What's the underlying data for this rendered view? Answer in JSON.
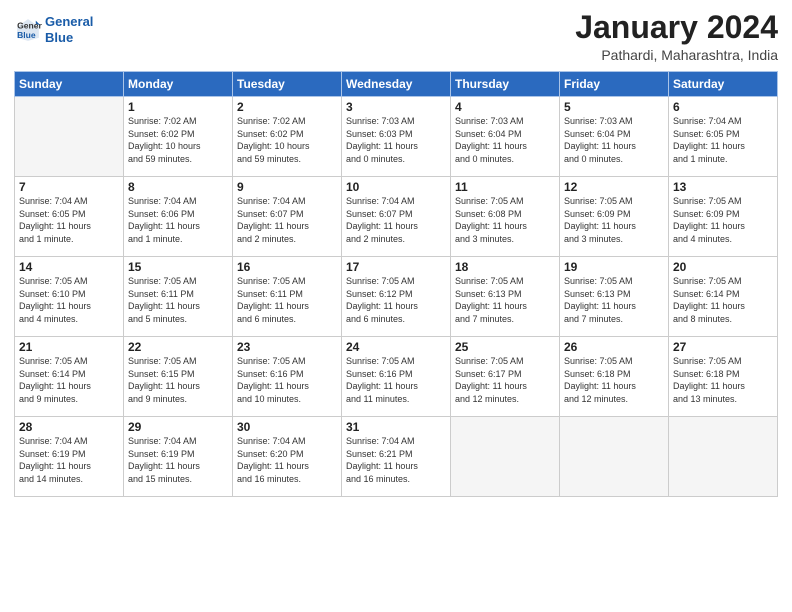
{
  "header": {
    "logo_line1": "General",
    "logo_line2": "Blue",
    "month": "January 2024",
    "location": "Pathardi, Maharashtra, India"
  },
  "weekdays": [
    "Sunday",
    "Monday",
    "Tuesday",
    "Wednesday",
    "Thursday",
    "Friday",
    "Saturday"
  ],
  "weeks": [
    [
      {
        "day": "",
        "empty": true
      },
      {
        "day": "1",
        "sunrise": "7:02 AM",
        "sunset": "6:02 PM",
        "daylight": "10 hours and 59 minutes."
      },
      {
        "day": "2",
        "sunrise": "7:02 AM",
        "sunset": "6:02 PM",
        "daylight": "10 hours and 59 minutes."
      },
      {
        "day": "3",
        "sunrise": "7:03 AM",
        "sunset": "6:03 PM",
        "daylight": "11 hours and 0 minutes."
      },
      {
        "day": "4",
        "sunrise": "7:03 AM",
        "sunset": "6:04 PM",
        "daylight": "11 hours and 0 minutes."
      },
      {
        "day": "5",
        "sunrise": "7:03 AM",
        "sunset": "6:04 PM",
        "daylight": "11 hours and 0 minutes."
      },
      {
        "day": "6",
        "sunrise": "7:04 AM",
        "sunset": "6:05 PM",
        "daylight": "11 hours and 1 minute."
      }
    ],
    [
      {
        "day": "7",
        "sunrise": "7:04 AM",
        "sunset": "6:05 PM",
        "daylight": "11 hours and 1 minute."
      },
      {
        "day": "8",
        "sunrise": "7:04 AM",
        "sunset": "6:06 PM",
        "daylight": "11 hours and 1 minute."
      },
      {
        "day": "9",
        "sunrise": "7:04 AM",
        "sunset": "6:07 PM",
        "daylight": "11 hours and 2 minutes."
      },
      {
        "day": "10",
        "sunrise": "7:04 AM",
        "sunset": "6:07 PM",
        "daylight": "11 hours and 2 minutes."
      },
      {
        "day": "11",
        "sunrise": "7:05 AM",
        "sunset": "6:08 PM",
        "daylight": "11 hours and 3 minutes."
      },
      {
        "day": "12",
        "sunrise": "7:05 AM",
        "sunset": "6:09 PM",
        "daylight": "11 hours and 3 minutes."
      },
      {
        "day": "13",
        "sunrise": "7:05 AM",
        "sunset": "6:09 PM",
        "daylight": "11 hours and 4 minutes."
      }
    ],
    [
      {
        "day": "14",
        "sunrise": "7:05 AM",
        "sunset": "6:10 PM",
        "daylight": "11 hours and 4 minutes."
      },
      {
        "day": "15",
        "sunrise": "7:05 AM",
        "sunset": "6:11 PM",
        "daylight": "11 hours and 5 minutes."
      },
      {
        "day": "16",
        "sunrise": "7:05 AM",
        "sunset": "6:11 PM",
        "daylight": "11 hours and 6 minutes."
      },
      {
        "day": "17",
        "sunrise": "7:05 AM",
        "sunset": "6:12 PM",
        "daylight": "11 hours and 6 minutes."
      },
      {
        "day": "18",
        "sunrise": "7:05 AM",
        "sunset": "6:13 PM",
        "daylight": "11 hours and 7 minutes."
      },
      {
        "day": "19",
        "sunrise": "7:05 AM",
        "sunset": "6:13 PM",
        "daylight": "11 hours and 7 minutes."
      },
      {
        "day": "20",
        "sunrise": "7:05 AM",
        "sunset": "6:14 PM",
        "daylight": "11 hours and 8 minutes."
      }
    ],
    [
      {
        "day": "21",
        "sunrise": "7:05 AM",
        "sunset": "6:14 PM",
        "daylight": "11 hours and 9 minutes."
      },
      {
        "day": "22",
        "sunrise": "7:05 AM",
        "sunset": "6:15 PM",
        "daylight": "11 hours and 9 minutes."
      },
      {
        "day": "23",
        "sunrise": "7:05 AM",
        "sunset": "6:16 PM",
        "daylight": "11 hours and 10 minutes."
      },
      {
        "day": "24",
        "sunrise": "7:05 AM",
        "sunset": "6:16 PM",
        "daylight": "11 hours and 11 minutes."
      },
      {
        "day": "25",
        "sunrise": "7:05 AM",
        "sunset": "6:17 PM",
        "daylight": "11 hours and 12 minutes."
      },
      {
        "day": "26",
        "sunrise": "7:05 AM",
        "sunset": "6:18 PM",
        "daylight": "11 hours and 12 minutes."
      },
      {
        "day": "27",
        "sunrise": "7:05 AM",
        "sunset": "6:18 PM",
        "daylight": "11 hours and 13 minutes."
      }
    ],
    [
      {
        "day": "28",
        "sunrise": "7:04 AM",
        "sunset": "6:19 PM",
        "daylight": "11 hours and 14 minutes."
      },
      {
        "day": "29",
        "sunrise": "7:04 AM",
        "sunset": "6:19 PM",
        "daylight": "11 hours and 15 minutes."
      },
      {
        "day": "30",
        "sunrise": "7:04 AM",
        "sunset": "6:20 PM",
        "daylight": "11 hours and 16 minutes."
      },
      {
        "day": "31",
        "sunrise": "7:04 AM",
        "sunset": "6:21 PM",
        "daylight": "11 hours and 16 minutes."
      },
      {
        "day": "",
        "empty": true
      },
      {
        "day": "",
        "empty": true
      },
      {
        "day": "",
        "empty": true
      }
    ]
  ]
}
